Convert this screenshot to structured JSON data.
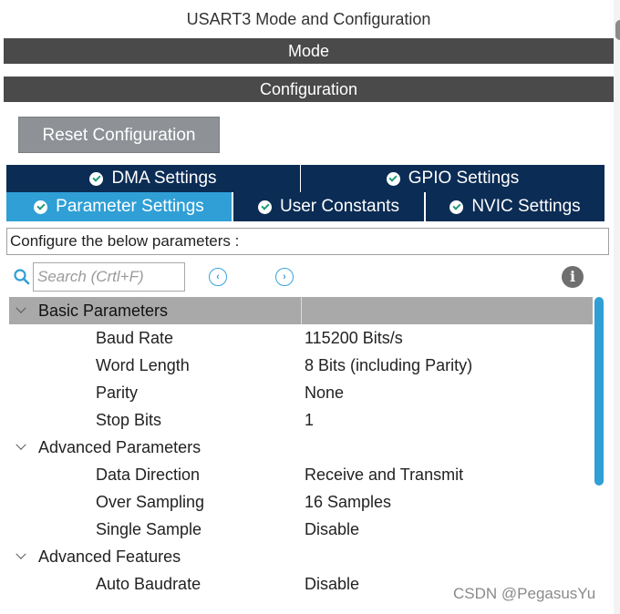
{
  "window": {
    "title": "USART3 Mode and Configuration"
  },
  "sections": {
    "mode_label": "Mode",
    "configuration_label": "Configuration"
  },
  "reset_button": {
    "label": "Reset Configuration"
  },
  "tabs": {
    "row1": [
      {
        "label": "DMA Settings",
        "active": false
      },
      {
        "label": "GPIO Settings",
        "active": false
      }
    ],
    "row2": [
      {
        "label": "Parameter Settings",
        "active": true
      },
      {
        "label": "User Constants",
        "active": false
      },
      {
        "label": "NVIC Settings",
        "active": false
      }
    ]
  },
  "description": "Configure the below parameters :",
  "search": {
    "placeholder": "Search (Crtl+F)",
    "value": ""
  },
  "groups": [
    {
      "name": "Basic Parameters",
      "params": [
        {
          "name": "Baud Rate",
          "value": "115200 Bits/s"
        },
        {
          "name": "Word Length",
          "value": "8 Bits (including Parity)"
        },
        {
          "name": "Parity",
          "value": "None"
        },
        {
          "name": "Stop Bits",
          "value": "1"
        }
      ]
    },
    {
      "name": "Advanced Parameters",
      "params": [
        {
          "name": "Data Direction",
          "value": "Receive and Transmit"
        },
        {
          "name": "Over Sampling",
          "value": "16 Samples"
        },
        {
          "name": "Single Sample",
          "value": "Disable"
        }
      ]
    },
    {
      "name": "Advanced Features",
      "params": [
        {
          "name": "Auto Baudrate",
          "value": "Disable"
        }
      ]
    }
  ],
  "watermark": "CSDN @PegasusYu",
  "colors": {
    "active_tab": "#2f9fd6",
    "inactive_tab": "#0b2c54",
    "section_bar": "#4a4a4a",
    "group_header": "#a9a9a9",
    "scrollbar": "#2f9fd6"
  },
  "icons": {
    "tab_status": "check-circle-icon",
    "search": "search-icon",
    "prev": "chevron-left-circle-icon",
    "next": "chevron-right-circle-icon",
    "info": "info-icon",
    "expand": "chevron-down-icon"
  }
}
